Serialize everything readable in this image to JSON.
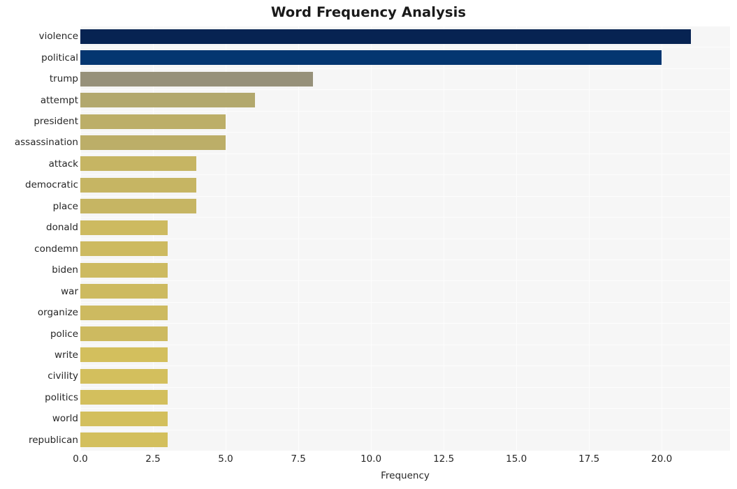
{
  "chart_data": {
    "type": "bar",
    "orientation": "horizontal",
    "title": "Word Frequency Analysis",
    "xlabel": "Frequency",
    "ylabel": "",
    "categories": [
      "violence",
      "political",
      "trump",
      "attempt",
      "president",
      "assassination",
      "attack",
      "democratic",
      "place",
      "donald",
      "condemn",
      "biden",
      "war",
      "organize",
      "police",
      "write",
      "civility",
      "politics",
      "world",
      "republican"
    ],
    "values": [
      21,
      20,
      8,
      6,
      5,
      5,
      4,
      4,
      4,
      3,
      3,
      3,
      3,
      3,
      3,
      3,
      3,
      3,
      3,
      3
    ],
    "bar_colors": [
      "#072352",
      "#043670",
      "#97917a",
      "#b2a86d",
      "#bcae68",
      "#bcae68",
      "#c6b563",
      "#c6b563",
      "#c6b563",
      "#cdba60",
      "#cdba60",
      "#cdba60",
      "#cdba60",
      "#cdba60",
      "#cdba60",
      "#d3bf5d",
      "#d3bf5d",
      "#d3bf5d",
      "#d3bf5d",
      "#d3bf5d"
    ],
    "xlim": [
      0,
      22.35
    ],
    "xticks": [
      0.0,
      2.5,
      5.0,
      7.5,
      10.0,
      12.5,
      15.0,
      17.5,
      20.0
    ],
    "xtick_labels": [
      "0.0",
      "2.5",
      "5.0",
      "7.5",
      "10.0",
      "12.5",
      "15.0",
      "17.5",
      "20.0"
    ],
    "grid": true,
    "grid_color": "#fdfdfd",
    "plot_background": "#f6f6f6",
    "figure_background": "#ffffff",
    "legend": null
  }
}
